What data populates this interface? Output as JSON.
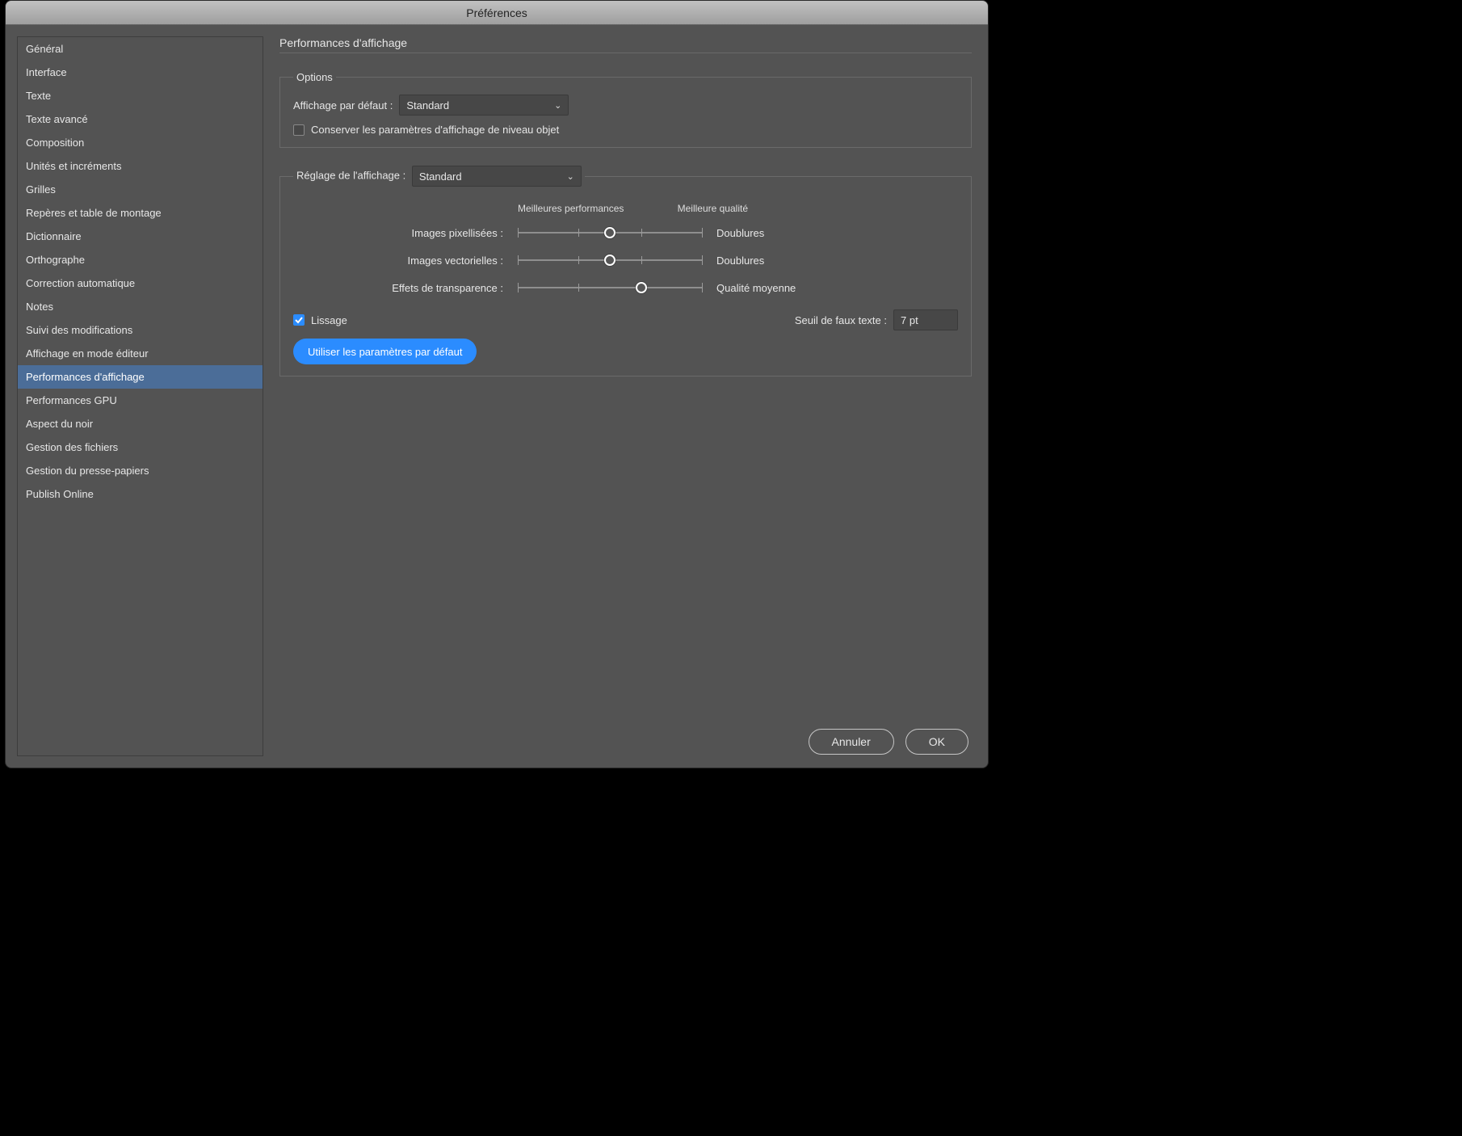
{
  "window": {
    "title": "Préférences"
  },
  "sidebar": {
    "items": [
      "Général",
      "Interface",
      "Texte",
      "Texte avancé",
      "Composition",
      "Unités et incréments",
      "Grilles",
      "Repères et table de montage",
      "Dictionnaire",
      "Orthographe",
      "Correction automatique",
      "Notes",
      "Suivi des modifications",
      "Affichage en mode éditeur",
      "Performances d'affichage",
      "Performances GPU",
      "Aspect du noir",
      "Gestion des fichiers",
      "Gestion du presse-papiers",
      "Publish Online"
    ],
    "selected_index": 14
  },
  "main": {
    "title": "Performances d'affichage",
    "options": {
      "legend": "Options",
      "default_display_label": "Affichage par défaut :",
      "default_display_value": "Standard",
      "preserve_obj_label": "Conserver les paramètres d'affichage de niveau objet",
      "preserve_obj_checked": false
    },
    "display_settings": {
      "legend_label": "Réglage de l'affichage :",
      "legend_value": "Standard",
      "scale_left": "Meilleures performances",
      "scale_right": "Meilleure qualité",
      "sliders": [
        {
          "caption": "Images pixellisées :",
          "pos": 0.5,
          "value": "Doublures"
        },
        {
          "caption": "Images vectorielles :",
          "pos": 0.5,
          "value": "Doublures"
        },
        {
          "caption": "Effets de transparence :",
          "pos": 0.67,
          "value": "Qualité moyenne"
        }
      ],
      "antialias_label": "Lissage",
      "antialias_checked": true,
      "fake_text_label": "Seuil de faux texte :",
      "fake_text_value": "7 pt",
      "reset_button": "Utiliser les paramètres par défaut"
    }
  },
  "footer": {
    "cancel": "Annuler",
    "ok": "OK"
  }
}
